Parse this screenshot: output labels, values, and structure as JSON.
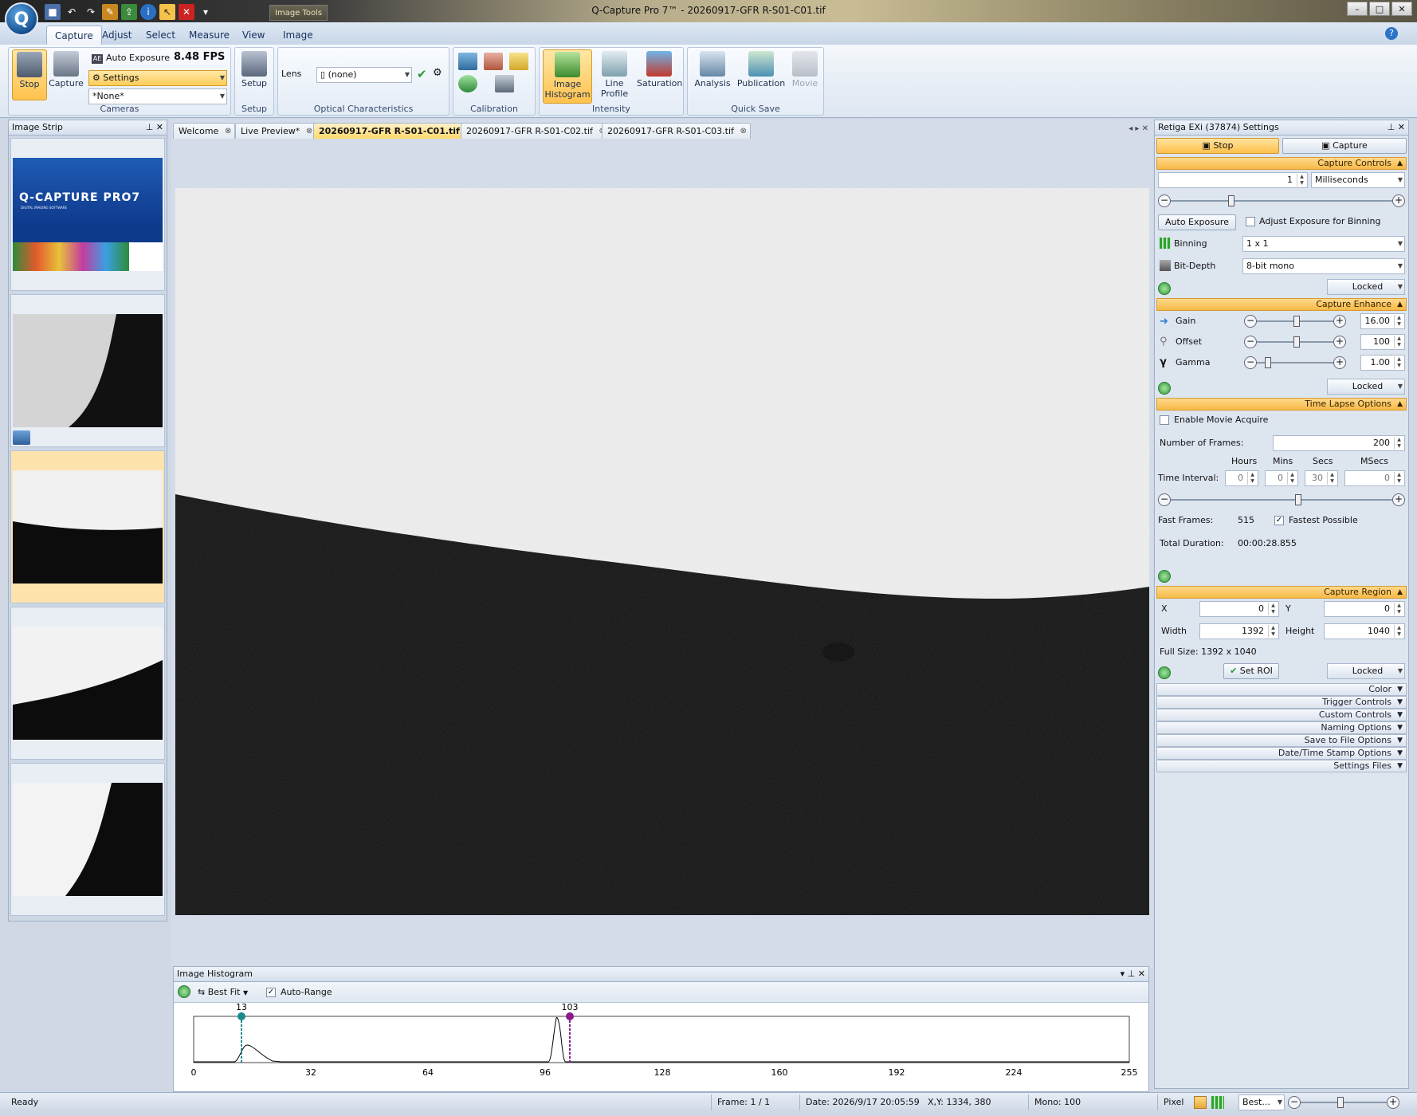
{
  "window": {
    "title": "Q-Capture Pro 7™ - 20260917-GFR R-S01-C01.tif",
    "context_tab": "Image Tools",
    "logo": "Q"
  },
  "ribbon_tabs": [
    "Capture",
    "Adjust",
    "Select",
    "Measure",
    "View",
    "Image"
  ],
  "ribbon": {
    "cameras": {
      "stop": "Stop",
      "capture": "Capture",
      "auto_exposure": "Auto Exposure",
      "fps": "8.48 FPS",
      "settings": "Settings",
      "preset": "*None*",
      "label": "Cameras"
    },
    "setup": {
      "button": "Setup",
      "label": "Setup"
    },
    "optical": {
      "lens_label": "Lens",
      "lens_value": "(none)",
      "label": "Optical Characteristics"
    },
    "calibration": {
      "label": "Calibration"
    },
    "intensity": {
      "histogram": "Image Histogram",
      "line_profile": "Line Profile",
      "saturation": "Saturation",
      "label": "Intensity"
    },
    "quick_save": {
      "analysis": "Analysis",
      "publication": "Publication",
      "movie": "Movie",
      "label": "Quick Save"
    }
  },
  "image_strip": {
    "title": "Image Strip",
    "splash_title": "Q-CAPTURE PRO7",
    "splash_subtitle": "DIGITAL IMAGING SOFTWARE"
  },
  "doc_tabs": [
    "Welcome",
    "Live Preview*",
    "20260917-GFR R-S01-C01.tif",
    "20260917-GFR R-S01-C02.tif",
    "20260917-GFR R-S01-C03.tif"
  ],
  "histogram": {
    "title": "Image Histogram",
    "fit": "Best Fit",
    "auto_range": "Auto-Range",
    "min_marker": "13",
    "max_marker": "103",
    "ticks": [
      "0",
      "32",
      "64",
      "96",
      "128",
      "160",
      "192",
      "224",
      "255"
    ]
  },
  "settings": {
    "title": "Retiga EXi (37874) Settings",
    "stop": "Stop",
    "capture": "Capture",
    "capture_controls": "Capture Controls",
    "exposure_value": "1",
    "exposure_unit": "Milliseconds",
    "auto_exposure": "Auto Exposure",
    "adjust_binning": "Adjust Exposure for Binning",
    "binning_label": "Binning",
    "binning_value": "1 x 1",
    "bitdepth_label": "Bit-Depth",
    "bitdepth_value": "8-bit mono",
    "locked": "Locked",
    "capture_enhance": "Capture Enhance",
    "gain_label": "Gain",
    "gain_value": "16.00",
    "offset_label": "Offset",
    "offset_value": "100",
    "gamma_label": "Gamma",
    "gamma_value": "1.00",
    "time_lapse": "Time Lapse Options",
    "enable_movie": "Enable Movie Acquire",
    "num_frames_label": "Number of  Frames:",
    "num_frames_value": "200",
    "hours": "Hours",
    "mins": "Mins",
    "secs": "Secs",
    "msecs": "MSecs",
    "interval_label": "Time Interval:",
    "interval_hours": "0",
    "interval_mins": "0",
    "interval_secs": "30",
    "interval_msecs": "0",
    "fast_frames_label": "Fast Frames:",
    "fast_frames_value": "515",
    "fastest_possible": "Fastest Possible",
    "total_duration_label": "Total Duration:",
    "total_duration_value": "00:00:28.855",
    "capture_region": "Capture Region",
    "x_label": "X",
    "x_value": "0",
    "y_label": "Y",
    "y_value": "0",
    "width_label": "Width",
    "width_value": "1392",
    "height_label": "Height",
    "height_value": "1040",
    "full_size": "Full Size: 1392 x 1040",
    "set_roi": "Set ROI",
    "collapsed": [
      "Color",
      "Trigger Controls",
      "Custom Controls",
      "Naming Options",
      "Save to File Options",
      "Date/Time Stamp Options",
      "Settings Files"
    ]
  },
  "status": {
    "ready": "Ready",
    "frame": "Frame: 1 / 1",
    "date": "Date: 2026/9/17 20:05:59",
    "xy": "X,Y: 1334,  380",
    "mono": "Mono:  100",
    "pixel": "Pixel",
    "zoom": "Best..."
  }
}
